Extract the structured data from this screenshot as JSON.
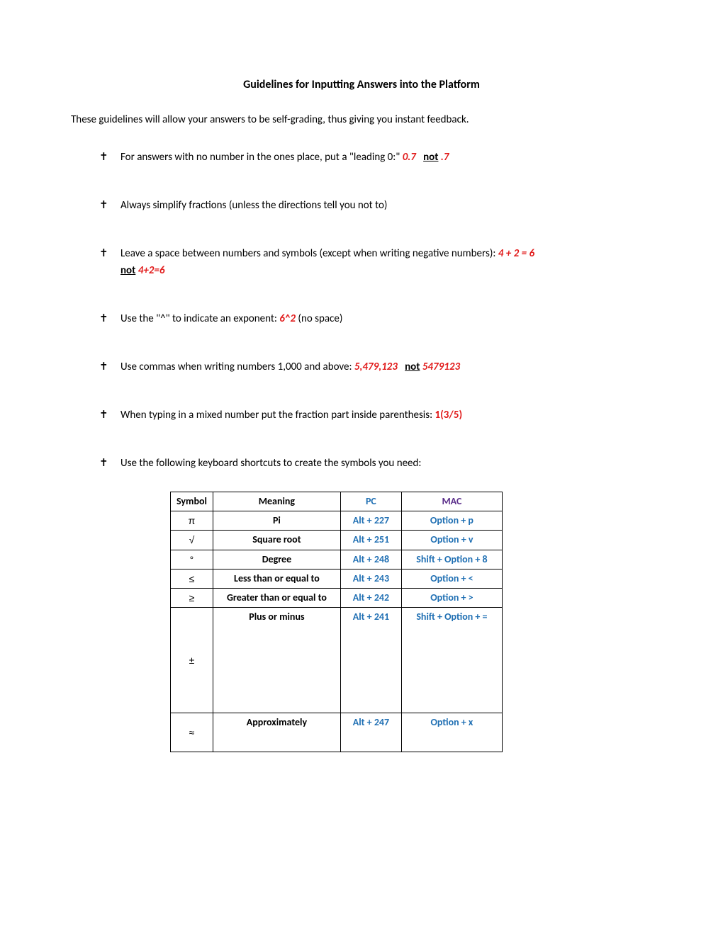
{
  "title": "Guidelines for Inputting Answers into the Platform",
  "intro": "These guidelines will allow your answers to be self-grading, thus giving you instant feedback.",
  "bullets": {
    "b1": {
      "text": "For answers with no number in the ones place, put a \"leading 0:\" ",
      "good": "0.7",
      "not": "not",
      "bad": " .7"
    },
    "b2": "Always simplify fractions (unless the directions tell you not to)",
    "b3": {
      "text": "Leave a space between numbers and symbols (except when writing negative numbers): ",
      "good": "4 + 2 = 6",
      "not": "not",
      "bad": " 4+2=6"
    },
    "b4": {
      "a": "Use the \"^\" to indicate an exponent: ",
      "code": "6^2",
      "b": " (no space)"
    },
    "b5": {
      "a": "Use commas when writing numbers 1,000 and above: ",
      "good": "5,479,123",
      "not": "not",
      "bad": " 5479123"
    },
    "b6": {
      "a": "When typing in a mixed number put the fraction part inside parenthesis: ",
      "code": "1(3/5)"
    },
    "b7": "Use the following keyboard shortcuts to create the symbols you need:"
  },
  "table": {
    "headers": {
      "sym": "Symbol",
      "mean": "Meaning",
      "pc": "PC",
      "mac": "MAC"
    },
    "rows": [
      {
        "sym": "π",
        "mean": "Pi",
        "pc": "Alt + 227",
        "mac": "Option + p"
      },
      {
        "sym": "√",
        "mean": "Square root",
        "pc": "Alt + 251",
        "mac": "Option + v"
      },
      {
        "sym": "°",
        "mean": "Degree",
        "pc": "Alt + 248",
        "mac": "Shift + Option + 8"
      },
      {
        "sym": "≤",
        "mean": "Less than or equal to",
        "pc": "Alt + 243",
        "mac": "Option + <"
      },
      {
        "sym": "≥",
        "mean": "Greater than or equal to",
        "pc": "Alt + 242",
        "mac": "Option + >"
      },
      {
        "sym": "±",
        "mean": "Plus or minus",
        "pc": "Alt + 241",
        "mac": "Shift + Option + ="
      },
      {
        "sym": "≈",
        "mean": "Approximately",
        "pc": "Alt + 247",
        "mac": "Option + x"
      }
    ]
  }
}
